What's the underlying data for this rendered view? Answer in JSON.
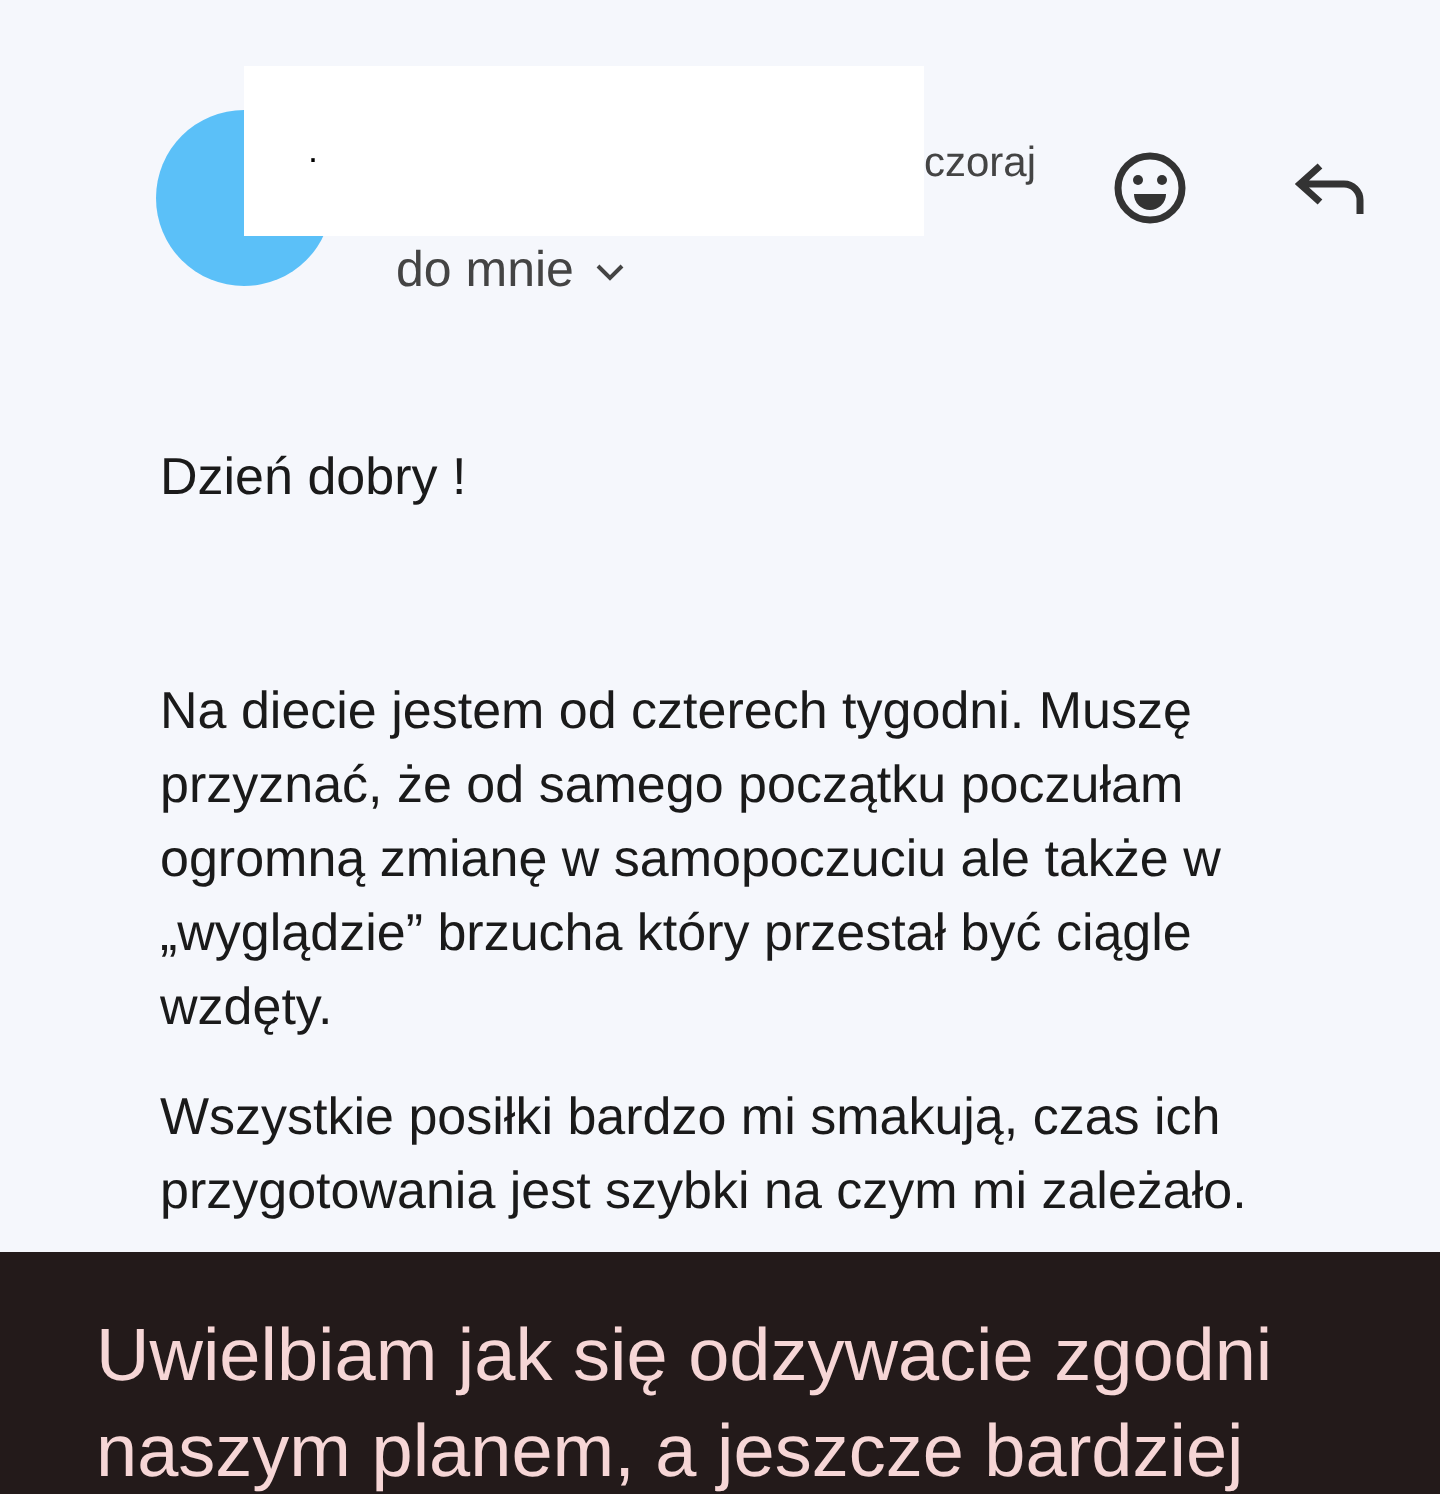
{
  "header": {
    "sender": ".",
    "time": "czoraj",
    "recipient": "do mnie"
  },
  "body": [
    {
      "lines": [
        "Dzień dobry !"
      ]
    },
    {
      "lines": [
        "Na diecie jestem od czterech tygodni. Muszę",
        "przyznać, że od samego początku poczułam",
        "ogromną zmianę w samopoczuciu ale także w",
        "„wyglądzie” brzucha który przestał być ciągle",
        "wzdęty."
      ]
    },
    {
      "lines": [
        "Wszystkie posiłki bardzo mi smakują, czas ich",
        "przygotowania jest szybki na czym mi zależało."
      ]
    }
  ],
  "caption": {
    "lines": [
      "Uwielbiam jak się odzywacie zgodni",
      "naszym planem, a jeszcze bardziej"
    ]
  }
}
